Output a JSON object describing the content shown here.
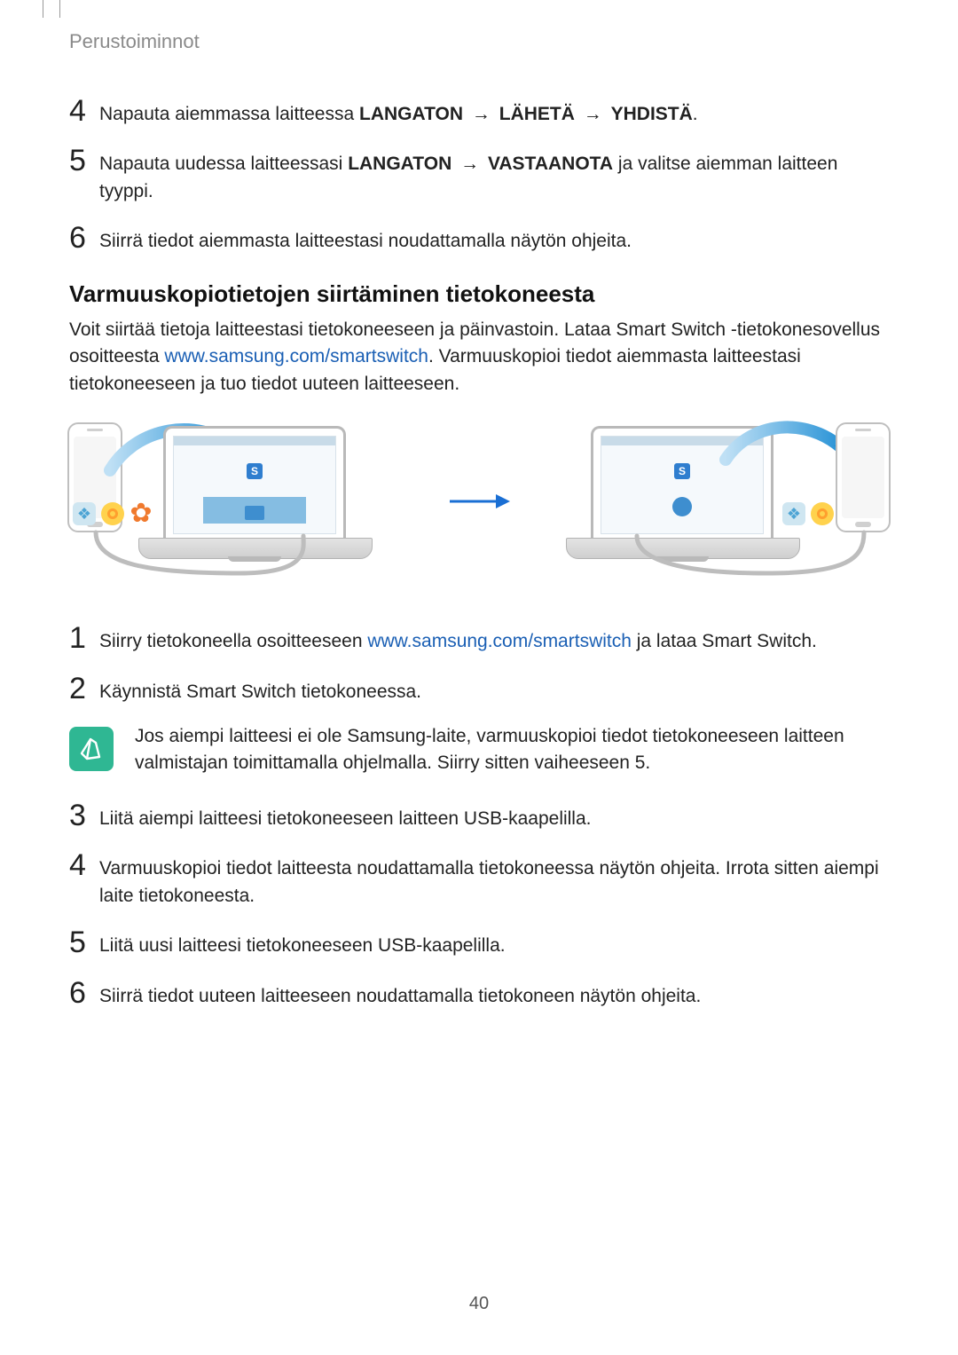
{
  "header": {
    "section": "Perustoiminnot"
  },
  "arrow_glyph": "→",
  "link": {
    "smartswitch": "www.samsung.com/smartswitch"
  },
  "first_list": {
    "items": [
      {
        "num": "4",
        "parts": [
          "Napauta aiemmassa laitteessa ",
          "LANGATON",
          "LÄHETÄ",
          "YHDISTÄ",
          "."
        ]
      },
      {
        "num": "5",
        "parts": [
          "Napauta uudessa laitteessasi ",
          "LANGATON",
          "VASTAANOTA",
          " ja valitse aiemman laitteen tyyppi."
        ]
      },
      {
        "num": "6",
        "text": "Siirrä tiedot aiemmasta laitteestasi noudattamalla näytön ohjeita."
      }
    ]
  },
  "section": {
    "title": "Varmuuskopiotietojen siirtäminen tietokoneesta"
  },
  "para1": {
    "before": "Voit siirtää tietoja laitteestasi tietokoneeseen ja päinvastoin. Lataa Smart Switch -tietokonesovellus osoitteesta ",
    "after": ". Varmuuskopioi tiedot aiemmasta laitteestasi tietokoneeseen ja tuo tiedot uuteen laitteeseen."
  },
  "illus": {
    "app_letter": "S"
  },
  "second_list": {
    "items": [
      {
        "num": "1",
        "before": "Siirry tietokoneella osoitteeseen ",
        "after": " ja lataa Smart Switch."
      },
      {
        "num": "2",
        "text": "Käynnistä Smart Switch tietokoneessa."
      }
    ]
  },
  "note": {
    "text": "Jos aiempi laitteesi ei ole Samsung-laite, varmuuskopioi tiedot tietokoneeseen laitteen valmistajan toimittamalla ohjelmalla. Siirry sitten vaiheeseen 5."
  },
  "third_list": {
    "items": [
      {
        "num": "3",
        "text": "Liitä aiempi laitteesi tietokoneeseen laitteen USB-kaapelilla."
      },
      {
        "num": "4",
        "text": "Varmuuskopioi tiedot laitteesta noudattamalla tietokoneessa näytön ohjeita. Irrota sitten aiempi laite tietokoneesta."
      },
      {
        "num": "5",
        "text": "Liitä uusi laitteesi tietokoneeseen USB-kaapelilla."
      },
      {
        "num": "6",
        "text": "Siirrä tiedot uuteen laitteeseen noudattamalla tietokoneen näytön ohjeita."
      }
    ]
  },
  "page": {
    "number": "40"
  }
}
